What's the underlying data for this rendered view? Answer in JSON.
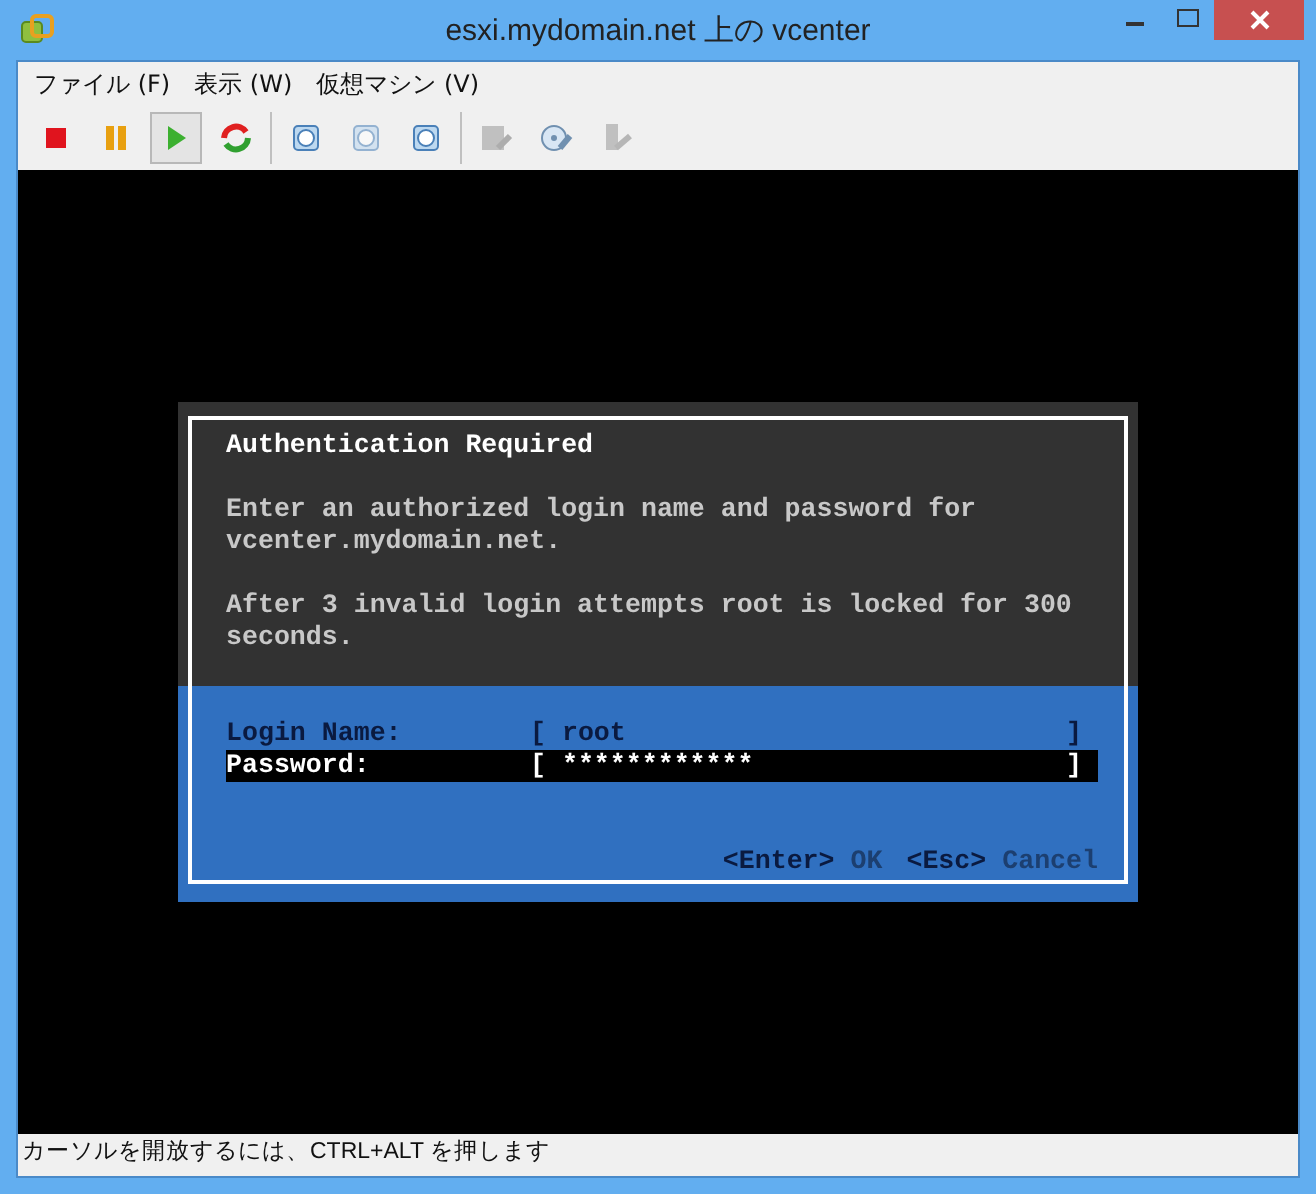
{
  "window": {
    "title": "esxi.mydomain.net 上の vcenter"
  },
  "menu": [
    {
      "label": "ファイル (F)"
    },
    {
      "label": "表示 (W)"
    },
    {
      "label": "仮想マシン (V)"
    }
  ],
  "toolbar": [
    {
      "kind": "stop",
      "selected": false,
      "disabled": false
    },
    {
      "kind": "pause",
      "selected": false,
      "disabled": false
    },
    {
      "kind": "play",
      "selected": true,
      "disabled": false
    },
    {
      "kind": "reset",
      "selected": false,
      "disabled": false
    },
    {
      "kind": "separator"
    },
    {
      "kind": "snapshot",
      "selected": false,
      "disabled": false
    },
    {
      "kind": "revert",
      "selected": false,
      "disabled": true
    },
    {
      "kind": "manage",
      "selected": false,
      "disabled": false
    },
    {
      "kind": "separator"
    },
    {
      "kind": "disk",
      "selected": false,
      "disabled": true
    },
    {
      "kind": "cd",
      "selected": false,
      "disabled": false
    },
    {
      "kind": "usb",
      "selected": false,
      "disabled": true
    }
  ],
  "dialog": {
    "title": "Authentication Required",
    "messages": [
      "Enter an authorized login name and password for\nvcenter.mydomain.net.",
      "After 3 invalid login attempts root is locked for 300\nseconds."
    ],
    "fields": [
      {
        "label": "Login Name:",
        "open": "[",
        "value": "root",
        "close": "]",
        "focused": false
      },
      {
        "label": "Password:",
        "open": "[",
        "value": "************",
        "close": "]",
        "focused": true
      }
    ],
    "actions": [
      {
        "key": "<Enter>",
        "label": "OK"
      },
      {
        "key": "<Esc>",
        "label": "Cancel"
      }
    ]
  },
  "status_bar": "カーソルを開放するには、CTRL+ALT を押します"
}
